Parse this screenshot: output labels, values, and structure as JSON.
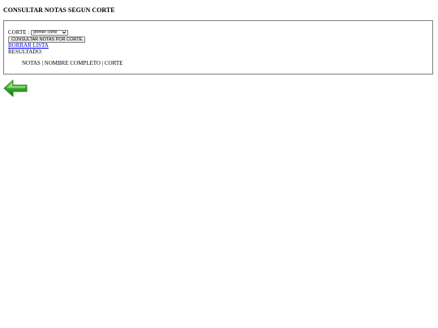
{
  "page": {
    "title": "CONSULTAR NOTAS SEGUN CORTE"
  },
  "form": {
    "corte_label": "CORTE :",
    "corte_selected": "primer corte",
    "consult_button_label": "CONSULTAR NOTAS POR CORTE",
    "clear_link_label": "BORRAR LISTA",
    "result_label": "RESULTADO:"
  },
  "results": {
    "columns": [
      "NOTAS",
      "NOMBRE COMPLETO",
      "CORTE"
    ],
    "header_text": "NOTAS | NOMBRE COMPLETO | CORTE"
  },
  "navigation": {
    "back_icon": "green-left-arrow-icon"
  },
  "colors": {
    "link": "#0000ee",
    "arrow_green": "#3aa82a",
    "panel_border": "#808080"
  }
}
